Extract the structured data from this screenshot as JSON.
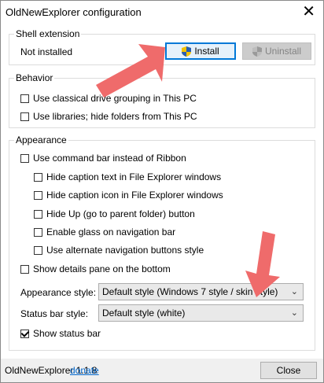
{
  "window": {
    "title": "OldNewExplorer configuration",
    "close_glyph": "✕"
  },
  "shell": {
    "legend": "Shell extension",
    "status": "Not installed",
    "install_label": "Install",
    "uninstall_label": "Uninstall"
  },
  "behavior": {
    "legend": "Behavior",
    "options": [
      {
        "label": "Use classical drive grouping in This PC",
        "checked": false
      },
      {
        "label": "Use libraries; hide folders from This PC",
        "checked": false
      }
    ]
  },
  "appearance": {
    "legend": "Appearance",
    "command_bar": {
      "label": "Use command bar instead of Ribbon",
      "checked": false
    },
    "sub_options": [
      {
        "label": "Hide caption text in File Explorer windows",
        "checked": false
      },
      {
        "label": "Hide caption icon in File Explorer windows",
        "checked": false
      },
      {
        "label": "Hide Up (go to parent folder) button",
        "checked": false
      },
      {
        "label": "Enable glass on navigation bar",
        "checked": false
      },
      {
        "label": "Use alternate navigation buttons style",
        "checked": false
      }
    ],
    "details_pane": {
      "label": "Show details pane on the bottom",
      "checked": false
    },
    "appearance_style_label": "Appearance style:",
    "appearance_style_value": "Default style (Windows 7 style / skin style)",
    "status_bar_style_label": "Status bar style:",
    "status_bar_style_value": "Default style (white)",
    "show_status_bar": {
      "label": "Show status bar",
      "checked": true
    }
  },
  "footer": {
    "version": "OldNewExplorer 1.1.8",
    "donate_link": "donate",
    "close_label": "Close"
  },
  "colors": {
    "arrow": "#ef6b6b",
    "link": "#0066cc",
    "accent": "#0078d7"
  },
  "icons": {
    "shield": "uac-shield-icon",
    "chevron": "chevron-down-icon"
  }
}
